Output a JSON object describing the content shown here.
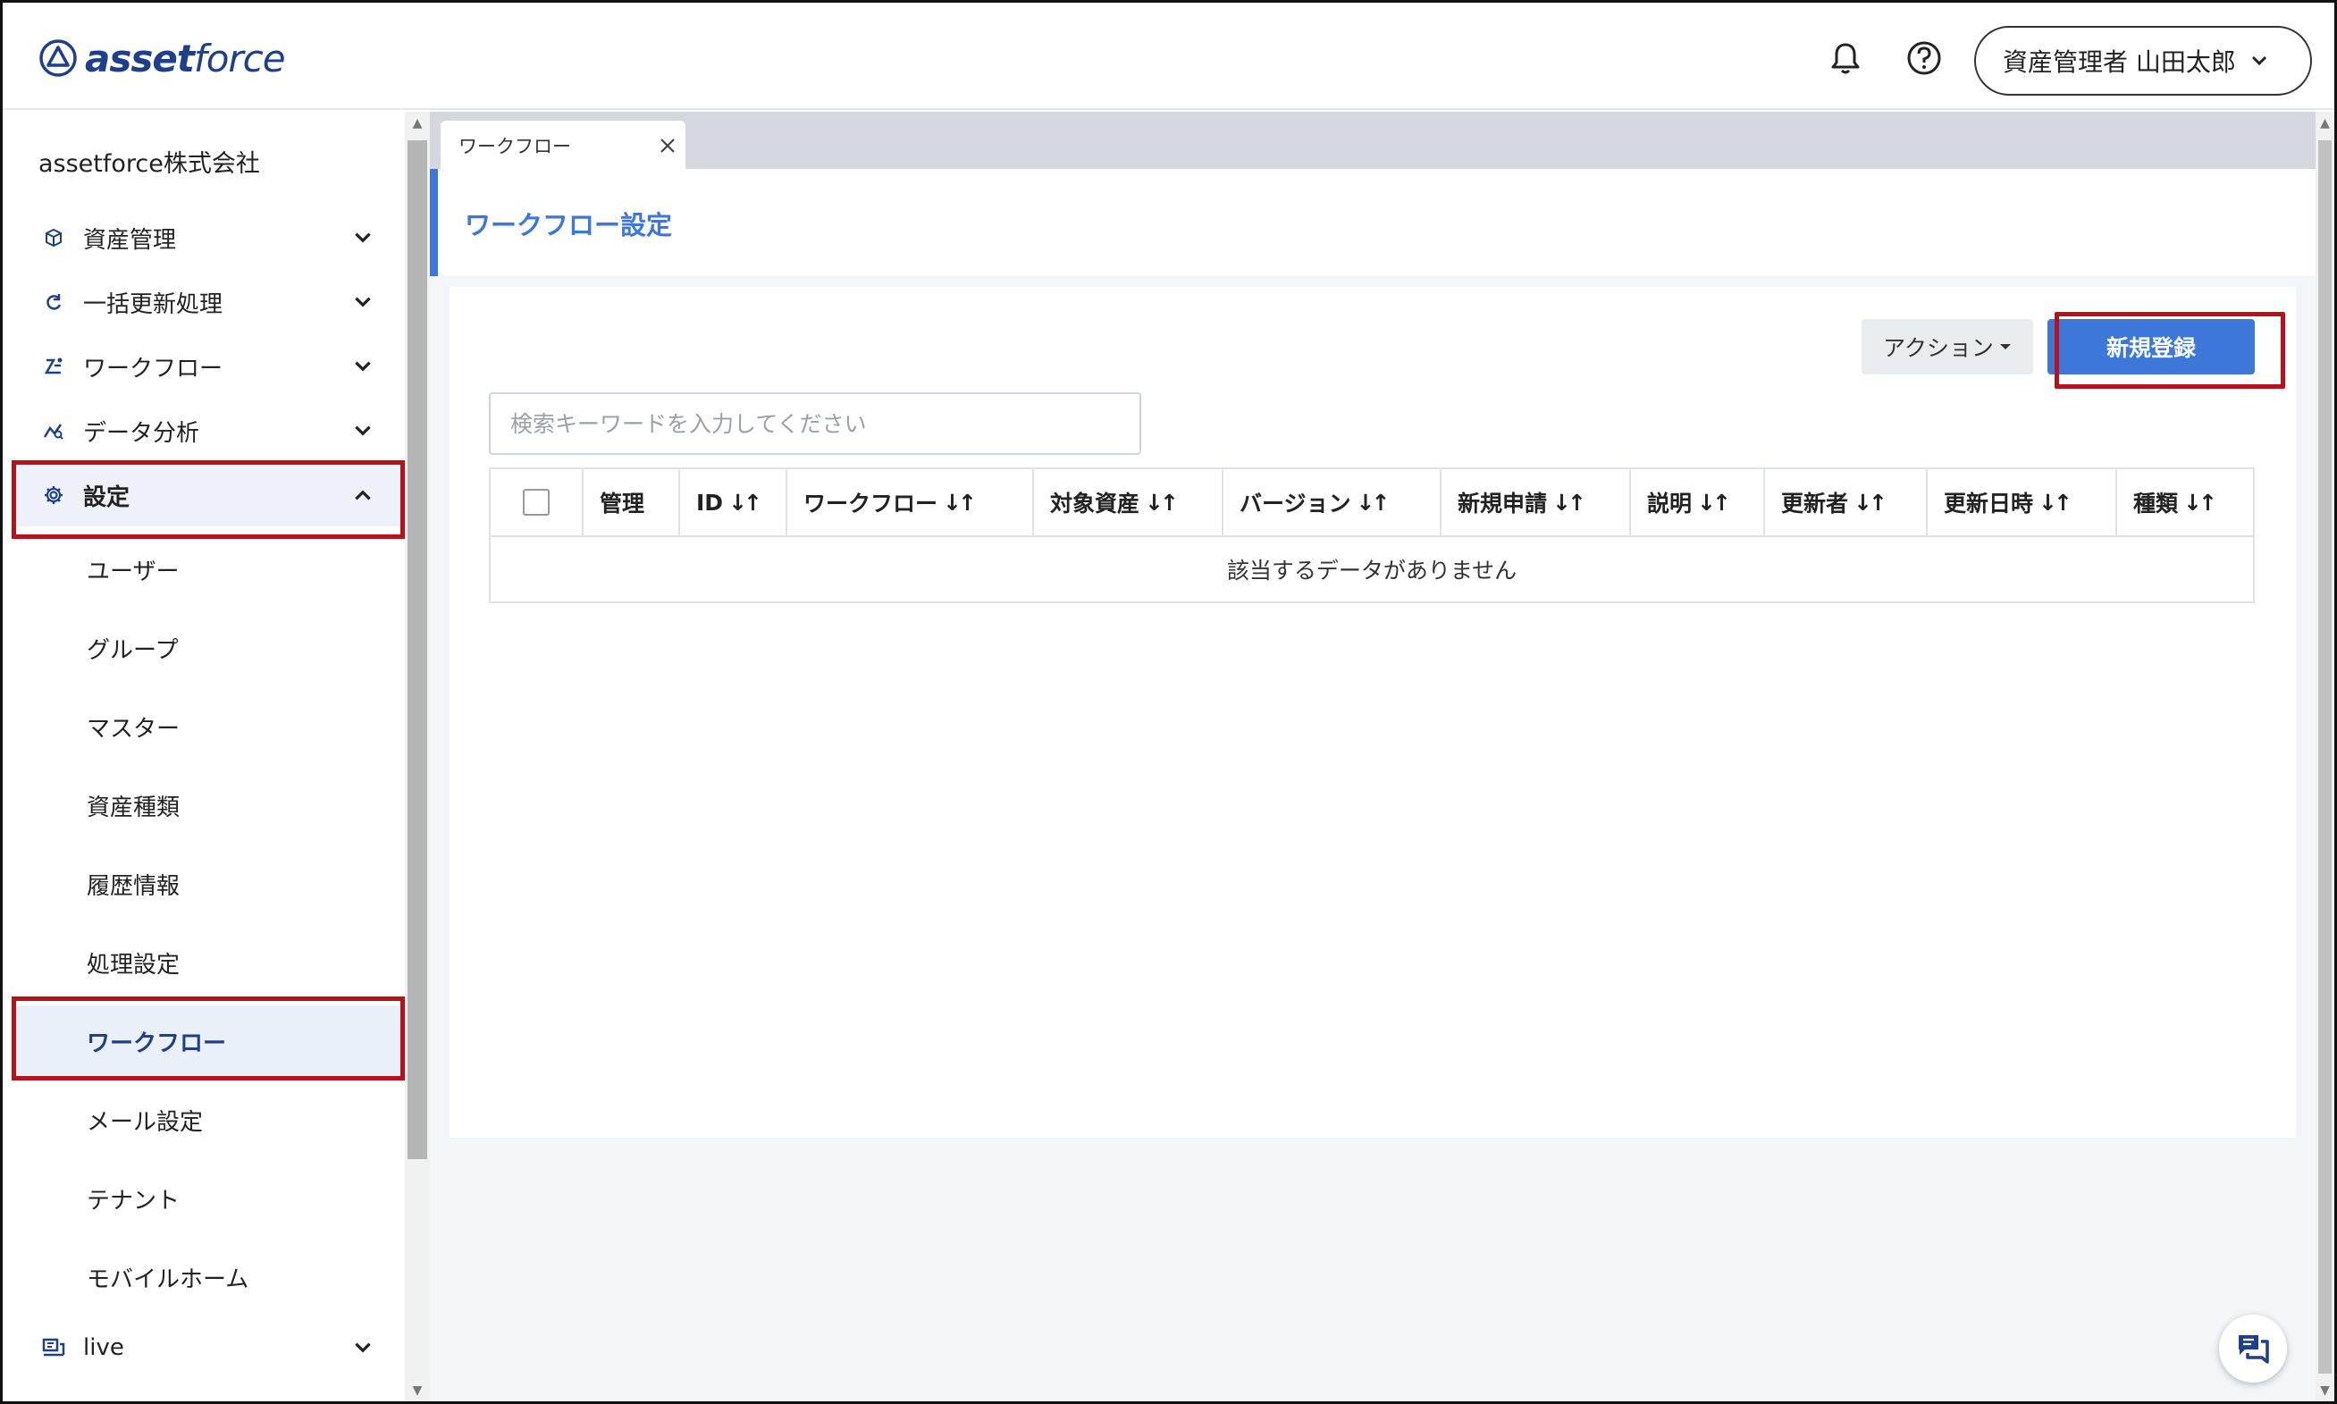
{
  "header": {
    "logo_text_bold": "asset",
    "logo_text": "force",
    "user_label": "資産管理者 山田太郎"
  },
  "sidebar": {
    "company": "assetforce株式会社",
    "items": [
      {
        "label": "資産管理",
        "icon": "box-icon"
      },
      {
        "label": "一括更新処理",
        "icon": "refresh-icon"
      },
      {
        "label": "ワークフロー",
        "icon": "workflow-icon"
      },
      {
        "label": "データ分析",
        "icon": "analytics-icon"
      },
      {
        "label": "設定",
        "icon": "gear-icon"
      }
    ],
    "sub_items": [
      "ユーザー",
      "グループ",
      "マスター",
      "資産種類",
      "履歴情報",
      "処理設定",
      "ワークフロー",
      "メール設定",
      "テナント",
      "モバイルホーム"
    ],
    "live": {
      "label": "live",
      "icon": "live-icon"
    }
  },
  "main": {
    "tab_label": "ワークフロー",
    "page_title": "ワークフロー設定",
    "action_label": "アクション",
    "new_label": "新規登録",
    "search_placeholder": "検索キーワードを入力してください",
    "columns": [
      "管理",
      "ID",
      "ワークフロー",
      "対象資産",
      "バージョン",
      "新規申請",
      "説明",
      "更新者",
      "更新日時",
      "種類"
    ],
    "empty_message": "該当するデータがありません"
  },
  "colors": {
    "brand": "#1e3f8a",
    "accent": "#3d78d8",
    "highlight": "#b5121b"
  }
}
